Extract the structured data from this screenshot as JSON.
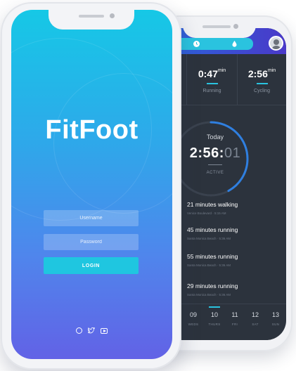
{
  "front": {
    "app_name": "FitFoot",
    "username_placeholder": "Username",
    "password_placeholder": "Password",
    "login_label": "LOGIN",
    "social_icons": [
      "dribbble-icon",
      "twitter-icon",
      "youtube-icon"
    ],
    "colors": {
      "gradient_top": "#16c8e6",
      "gradient_bottom": "#6262e6",
      "login_button": "#1fc6e0"
    }
  },
  "back": {
    "tab_icons": [
      "clock-icon",
      "drop-icon"
    ],
    "stats": [
      {
        "value": "0:47",
        "unit": "min",
        "label": "Running"
      },
      {
        "value": "2:56",
        "unit": "min",
        "label": "Cycling"
      }
    ],
    "summary": {
      "label": "Today",
      "time_main": "2:56:",
      "time_dim": "01",
      "status": "ACTIVE",
      "progress_fraction": 0.42
    },
    "activities": [
      {
        "title": "21 minutes walking",
        "sub": "Venice Boulevard · 5:15 AM"
      },
      {
        "title": "45 minutes running",
        "sub": "Santa Monica Beach · 5:36 AM"
      },
      {
        "title": "55 minutes running",
        "sub": "Santa Monica Beach · 5:36 AM"
      },
      {
        "title": "29 minutes running",
        "sub": "Santa Monica Beach · 5:36 AM"
      }
    ],
    "days": [
      {
        "num": "09",
        "name": "WEDS"
      },
      {
        "num": "10",
        "name": "THURS",
        "selected": true
      },
      {
        "num": "11",
        "name": "FRI"
      },
      {
        "num": "12",
        "name": "SAT"
      },
      {
        "num": "13",
        "name": "SUN"
      }
    ],
    "colors": {
      "screen": "#2c333d",
      "accent": "#2ac3df"
    }
  }
}
